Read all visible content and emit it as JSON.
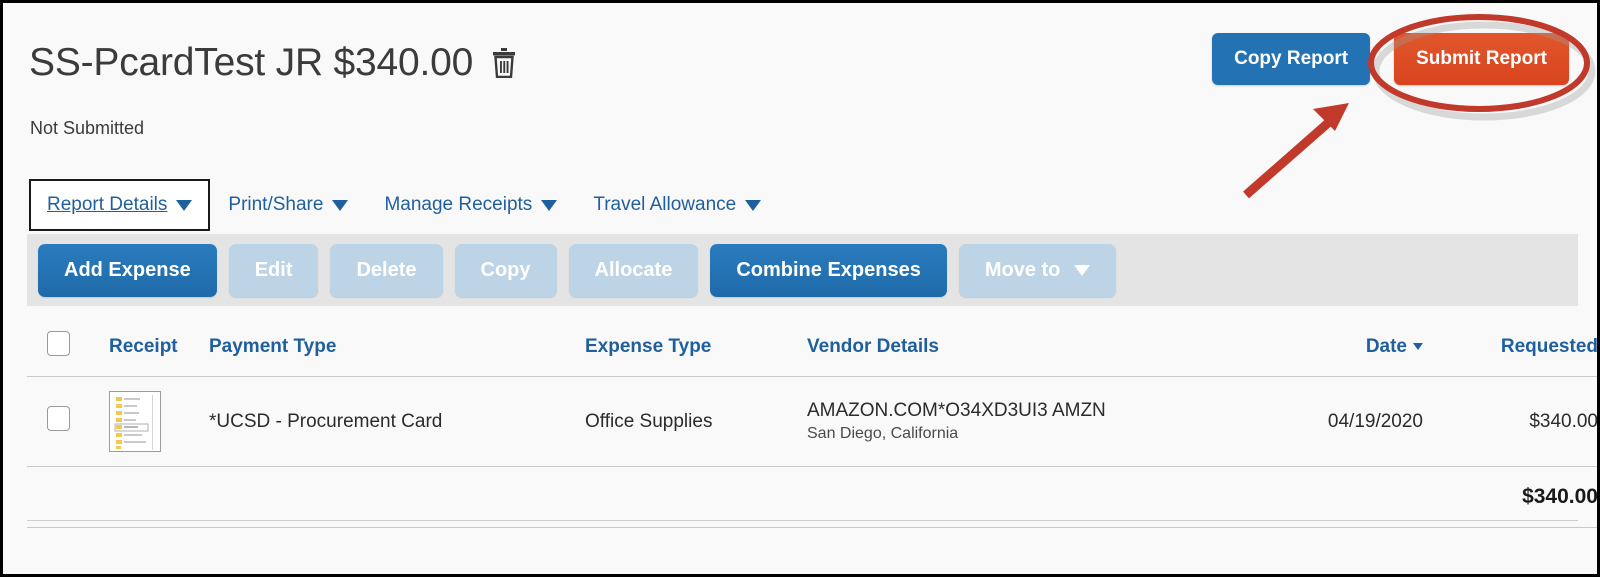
{
  "report": {
    "title": "SS-PcardTest JR $340.00",
    "status": "Not Submitted",
    "delete_icon": "trash-icon"
  },
  "top_actions": {
    "copy_report": "Copy Report",
    "submit_report": "Submit Report"
  },
  "tabs": [
    {
      "label": "Report Details",
      "caret": "chevron-down-icon",
      "active": true
    },
    {
      "label": "Print/Share",
      "caret": "chevron-down-icon",
      "active": false
    },
    {
      "label": "Manage Receipts",
      "caret": "chevron-down-icon",
      "active": false
    },
    {
      "label": "Travel Allowance",
      "caret": "chevron-down-icon",
      "active": false
    }
  ],
  "toolbar": {
    "add_expense": "Add Expense",
    "edit": "Edit",
    "delete": "Delete",
    "copy": "Copy",
    "allocate": "Allocate",
    "combine_expenses": "Combine Expenses",
    "move_to": "Move to"
  },
  "table": {
    "headers": {
      "receipt": "Receipt",
      "payment_type": "Payment Type",
      "expense_type": "Expense Type",
      "vendor_details": "Vendor Details",
      "date": "Date",
      "requested": "Requested"
    },
    "rows": [
      {
        "receipt": "receipt-thumbnail",
        "payment_type": "*UCSD - Procurement Card",
        "expense_type": "Office Supplies",
        "vendor_name": "AMAZON.COM*O34XD3UI3 AMZN",
        "vendor_location": "San Diego, California",
        "date": "04/19/2020",
        "requested": "$340.00"
      }
    ],
    "total": "$340.00"
  },
  "colors": {
    "primary_blue": "#2272b4",
    "disabled_blue": "#bcd4e6",
    "submit_orange": "#dd4b25",
    "link_blue": "#1f7ac2",
    "header_blue": "#1f5f9e",
    "toolbar_grey": "#e4e4e4",
    "annotation_red": "#c0392b"
  },
  "annotations": {
    "highlight_shape": "ellipse-around-submit-report",
    "pointer": "arrow-pointing-to-submit-report"
  }
}
